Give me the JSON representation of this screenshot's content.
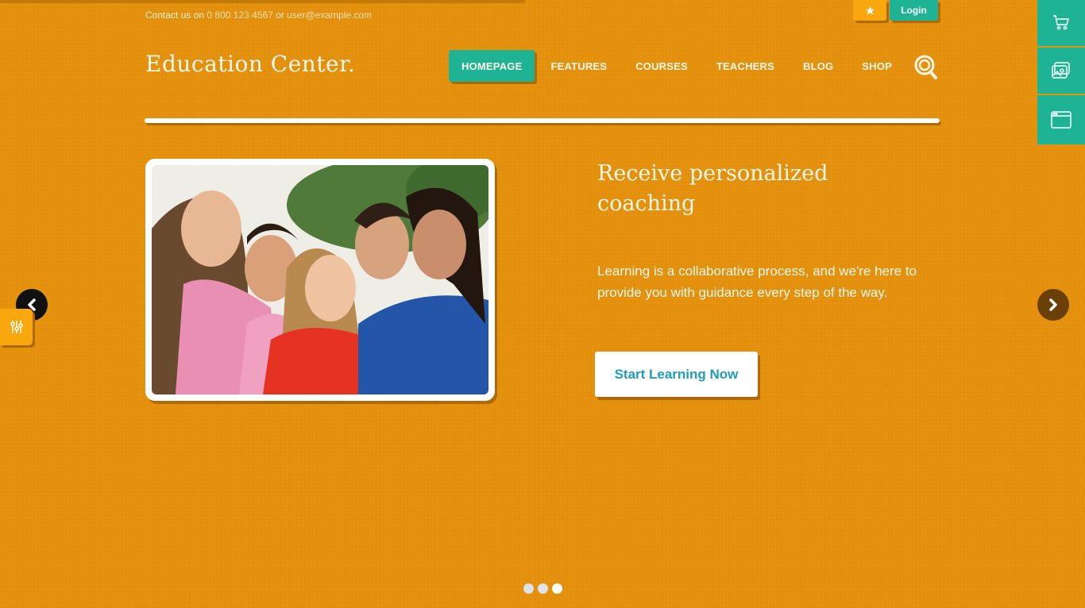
{
  "topbar": {
    "contact_prefix": "Contact us on",
    "phone": "0 800 123 4567",
    "separator": "or",
    "email": "user@example.com",
    "star_icon": "star-icon",
    "login_label": "Login"
  },
  "header": {
    "logo": "Education Center.",
    "nav": [
      {
        "label": "HOMEPAGE",
        "active": true
      },
      {
        "label": "FEATURES",
        "active": false
      },
      {
        "label": "COURSES",
        "active": false
      },
      {
        "label": "TEACHERS",
        "active": false
      },
      {
        "label": "BLOG",
        "active": false
      },
      {
        "label": "SHOP",
        "active": false
      }
    ],
    "search_icon": "search-icon"
  },
  "side_tools": [
    {
      "icon": "cart-icon"
    },
    {
      "icon": "gallery-icon"
    },
    {
      "icon": "browser-window-icon"
    }
  ],
  "slider": {
    "image_alt": "Group of five smiling students",
    "title": "Receive personalized coaching",
    "text": "Learning is a collaborative process, and we're here to provide you with guidance every step of the way.",
    "cta_label": "Start Learning Now",
    "slide_count": 3,
    "active_slide": 3
  },
  "colors": {
    "background": "#e4900a",
    "accent_green": "#1eb394",
    "accent_yellow": "#f8a80e",
    "cta_text": "#1d9cbf"
  }
}
